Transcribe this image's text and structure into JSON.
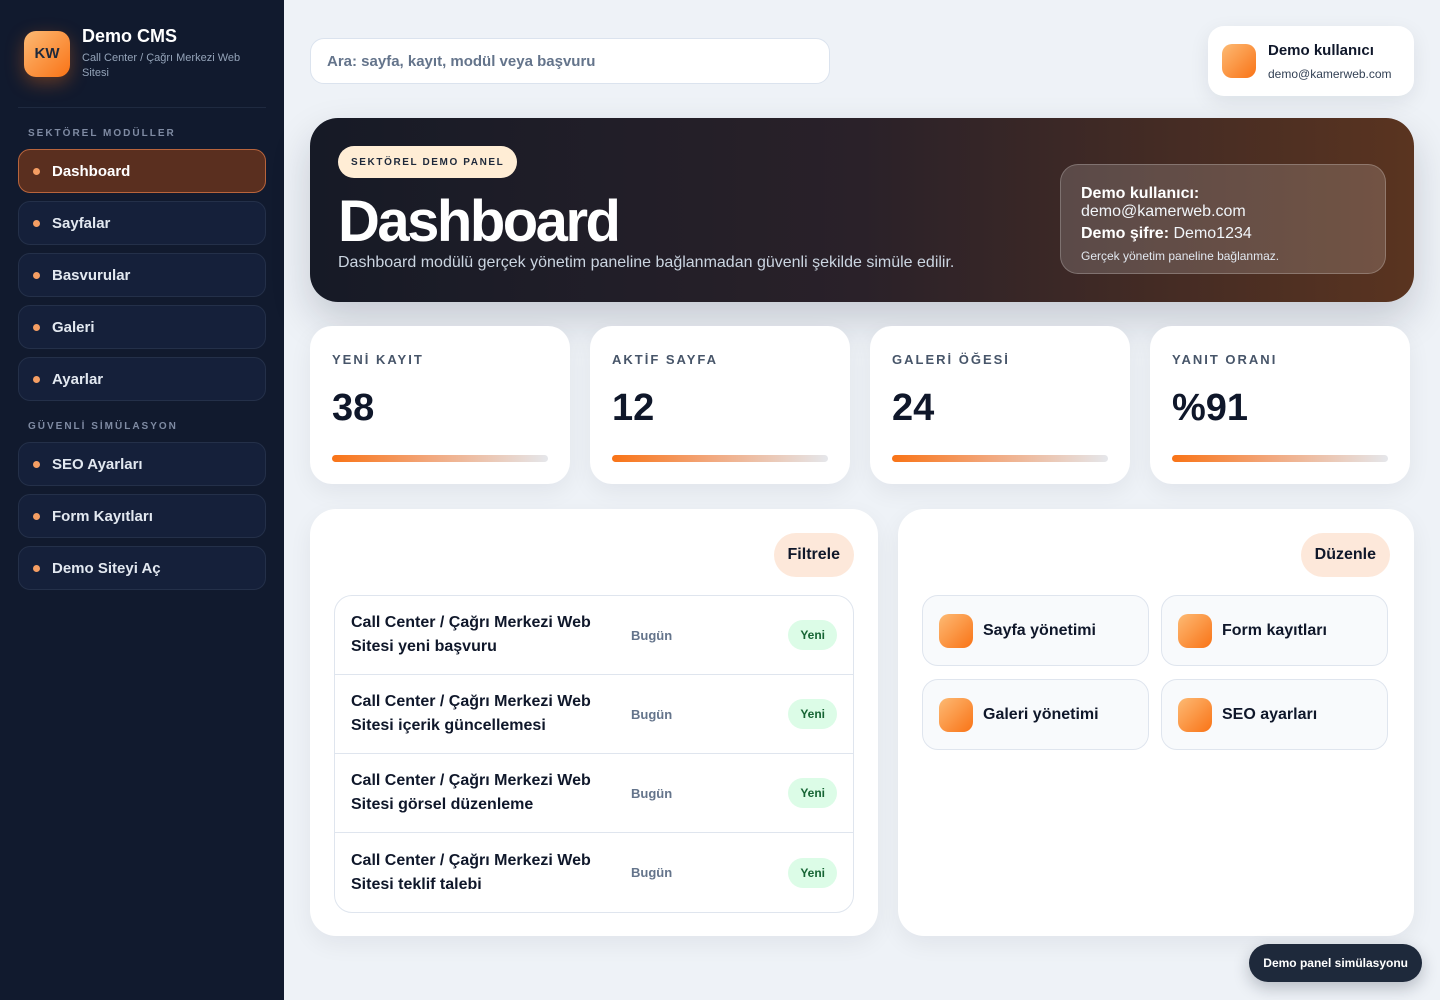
{
  "brand": {
    "logo_text": "KW",
    "title": "Demo CMS",
    "subtitle": "Call Center / Çağrı Merkezi Web Sitesi"
  },
  "sidebar": {
    "section1_label": "SEKTÖREL MODÜLLER",
    "section2_label": "GÜVENLİ SİMÜLASYON",
    "items": [
      {
        "label": "Dashboard"
      },
      {
        "label": "Sayfalar"
      },
      {
        "label": "Basvurular"
      },
      {
        "label": "Galeri"
      },
      {
        "label": "Ayarlar"
      }
    ],
    "items2": [
      {
        "label": "SEO Ayarları"
      },
      {
        "label": "Form Kayıtları"
      },
      {
        "label": "Demo Siteyi Aç"
      }
    ]
  },
  "search": {
    "placeholder": "Ara: sayfa, kayıt, modül veya başvuru"
  },
  "user": {
    "name": "Demo kullanıcı",
    "email": "demo@kamerweb.com"
  },
  "hero": {
    "badge": "SEKTÖREL DEMO PANEL",
    "title": "Dashboard",
    "description": "Dashboard modülü gerçek yönetim paneline bağlanmadan güvenli şekilde simüle edilir.",
    "info_user_label": "Demo kullanıcı:",
    "info_user_value": "demo@kamerweb.com",
    "info_pass_label": "Demo şifre:",
    "info_pass_value": "Demo1234",
    "info_note": "Gerçek yönetim paneline bağlanmaz."
  },
  "stats": [
    {
      "label": "YENİ KAYIT",
      "value": "38"
    },
    {
      "label": "AKTİF SAYFA",
      "value": "12"
    },
    {
      "label": "GALERİ ÖĞESİ",
      "value": "24"
    },
    {
      "label": "YANIT ORANI",
      "value": "%91"
    }
  ],
  "records": {
    "filter_label": "Filtrele",
    "rows": [
      {
        "title": "Call Center / Çağrı Merkezi Web Sitesi yeni başvuru",
        "date": "Bugün",
        "status": "Yeni"
      },
      {
        "title": "Call Center / Çağrı Merkezi Web Sitesi içerik güncellemesi",
        "date": "Bugün",
        "status": "Yeni"
      },
      {
        "title": "Call Center / Çağrı Merkezi Web Sitesi görsel düzenleme",
        "date": "Bugün",
        "status": "Yeni"
      },
      {
        "title": "Call Center / Çağrı Merkezi Web Sitesi teklif talebi",
        "date": "Bugün",
        "status": "Yeni"
      }
    ]
  },
  "modules": {
    "edit_label": "Düzenle",
    "tiles": [
      {
        "label": "Sayfa yönetimi"
      },
      {
        "label": "Form kayıtları"
      },
      {
        "label": "Galeri yönetimi"
      },
      {
        "label": "SEO ayarları"
      }
    ]
  },
  "floating": {
    "label": "Demo panel simülasyonu"
  },
  "colors": {
    "accent": "#f97316",
    "sidebar_bg": "#111a2e",
    "active_item": "#5a2f1f",
    "status_green": "#166534"
  }
}
